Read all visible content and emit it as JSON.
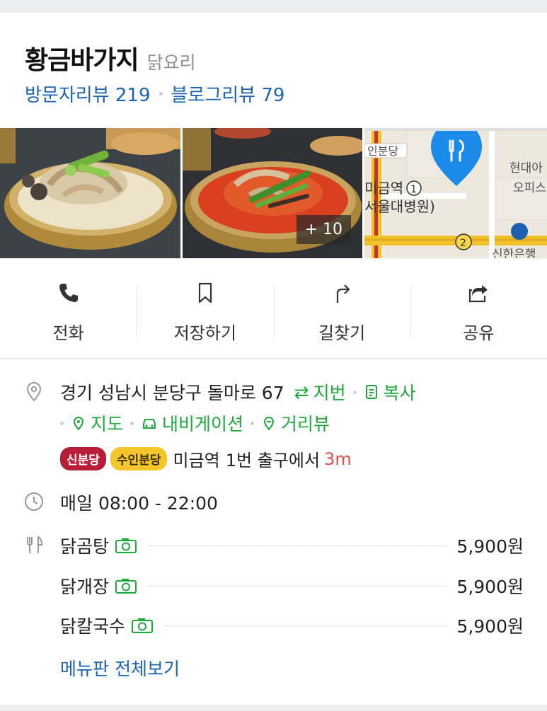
{
  "place": {
    "name": "황금바가지",
    "category": "닭요리",
    "visitor_review": "방문자리뷰 219",
    "blog_review": "블로그리뷰 79"
  },
  "photos": {
    "more_count": "+ 10",
    "map_labels": [
      "인분당",
      "미금역",
      "1",
      "서울대병원)",
      "현대아",
      "오피스",
      "2",
      "신한은행"
    ]
  },
  "actions": [
    {
      "label": "전화",
      "icon": "phone-icon"
    },
    {
      "label": "저장하기",
      "icon": "bookmark-icon"
    },
    {
      "label": "길찾기",
      "icon": "directions-icon"
    },
    {
      "label": "공유",
      "icon": "share-icon"
    }
  ],
  "address": {
    "text": "경기 성남시 분당구 돌마로 67",
    "lot_toggle": "지번",
    "copy": "복사",
    "map": "지도",
    "navigation": "내비게이션",
    "street_view": "거리뷰"
  },
  "subway": {
    "lines": [
      {
        "name": "신분당",
        "color": "#b71c38"
      },
      {
        "name": "수인분당",
        "color": "#f4c62a"
      }
    ],
    "station": "미금역",
    "exit_text": "1번 출구에서",
    "distance": "3m"
  },
  "hours": {
    "text": "매일 08:00 - 22:00"
  },
  "menu": {
    "items": [
      {
        "name": "닭곰탕",
        "price": "5,900원"
      },
      {
        "name": "닭개장",
        "price": "5,900원"
      },
      {
        "name": "닭칼국수",
        "price": "5,900원"
      }
    ],
    "view_all": "메뉴판 전체보기"
  },
  "colors": {
    "accent_blue": "#1b64b3",
    "accent_green": "#1ea93b",
    "map_pin": "#1a8be8"
  }
}
